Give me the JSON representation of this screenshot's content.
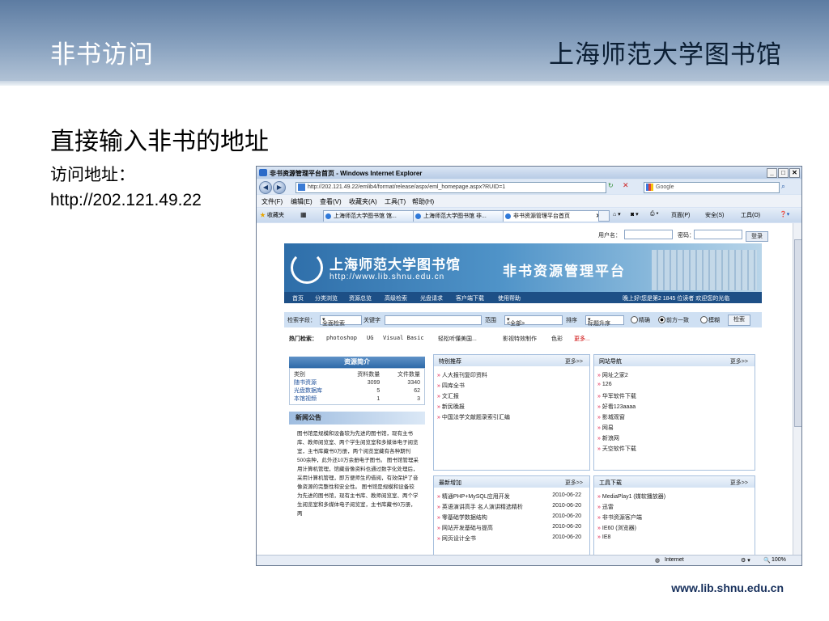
{
  "slide": {
    "title": "非书访问",
    "brand": "上海师范大学图书馆",
    "heading": "直接输入非书的地址",
    "label": "访问地址：",
    "address": "http://202.121.49.22",
    "footer_url": "www.lib.shnu.edu.cn"
  },
  "browser": {
    "window_title": "非书资源管理平台首页 - Windows Internet Explorer",
    "url": "http://202.121.49.22/emlib4/format/release/aspx/eml_homepage.aspx?RUID=1",
    "search_placeholder": "Google",
    "menu": [
      "文件(F)",
      "编辑(E)",
      "查看(V)",
      "收藏夹(A)",
      "工具(T)",
      "帮助(H)"
    ],
    "favorites_label": "收藏夹",
    "tabs": [
      "上海师范大学图书馆 馆...",
      "上海师范大学图书馆 非...",
      "非书资源管理平台首页"
    ],
    "tools": [
      "页面(P)",
      "安全(S)",
      "工具(O)"
    ],
    "status_zone": "Internet",
    "zoom": "100%"
  },
  "site": {
    "login": {
      "user_label": "用户名：",
      "pass_label": "密码：",
      "button": "登录"
    },
    "banner": {
      "name": "上海师范大学图书馆",
      "url": "http://www.lib.shnu.edu.cn",
      "platform": "非书资源管理平台"
    },
    "nav": [
      "首页",
      "分类浏览",
      "资源总览",
      "高级检索",
      "光盘请求",
      "客户端下载",
      "使用帮助"
    ],
    "greeting": "晚上好!您是第2 1845 位读者  欢迎您的光临",
    "search": {
      "field_label": "检索字段：",
      "field_value": "全面检索",
      "keyword_label": "关键字",
      "range_label": "范围",
      "range_value": "<全部>",
      "sort_label": "排序",
      "sort_value": "标题升序",
      "opt1": "精确",
      "opt2": "前方一致",
      "opt3": "模糊",
      "button": "检索"
    },
    "hot": {
      "label": "热门检索：",
      "items": [
        "photoshop",
        "UG",
        "Visual Basic",
        "轻松听懂美国...",
        "影视特效制作",
        "色彩",
        "更多..."
      ]
    },
    "stats": {
      "title": "资源简介",
      "headers": [
        "类别",
        "资料数量",
        "文件数量"
      ],
      "rows": [
        [
          "随书资源",
          "3099",
          "3340"
        ],
        [
          "光盘数据库",
          "5",
          "62"
        ],
        [
          "本馆视频",
          "1",
          "3"
        ]
      ]
    },
    "news": {
      "title": "新闻公告",
      "body": "图书馆是规模和设备较为先进的图书馆，现有主书库、教师阅览室、两个学生阅览室和多媒体电子阅览室，主书库藏书0万册，两个阅览室藏有各种期刊500余种，此外还10万余册电子图书。 图书馆管理采用计算机管理，馆藏音像资料也通过数字化处理后，采用计算机管理，即方便师生的借阅，有效保护了音像资源的完整性和安全性。 图书馆是规模和设备较为先进的图书馆，现有主书库、教师阅览室、两个学生阅览室和多媒体电子阅览室，主书库藏书0万册，两"
    },
    "panels": {
      "featured": {
        "title": "特别推荐",
        "more": "更多>>",
        "items": [
          "人大报刊复印资料",
          "四库全书",
          "文汇报",
          "新民晚报",
          "中国法学文献题录索引汇编"
        ]
      },
      "navsite": {
        "title": "网站导航",
        "more": "更多>>",
        "items": [
          "网址之家2",
          "126",
          "华军软件下载",
          "好看123aaaa",
          "影城观窗",
          "网易",
          "新浪网",
          "天空软件下载"
        ]
      },
      "latest": {
        "title": "最新增加",
        "more": "更多>>",
        "items": [
          {
            "t": "精通PHP+MySQL应用开发",
            "d": "2010-06-22"
          },
          {
            "t": "英语演讲高手 名人演讲精选精析",
            "d": "2010-06-20"
          },
          {
            "t": "零基础学数据结构",
            "d": "2010-06-20"
          },
          {
            "t": "网站开发基础与提高",
            "d": "2010-06-20"
          },
          {
            "t": "网页设计全书",
            "d": "2010-06-20"
          }
        ]
      },
      "tools": {
        "title": "工具下载",
        "more": "更多>>",
        "items": [
          "MediaPlay1 (媒软播放器)",
          "迅雷",
          "非书资源客户端",
          "IE60 (浏览器)",
          "IE8"
        ]
      }
    }
  }
}
